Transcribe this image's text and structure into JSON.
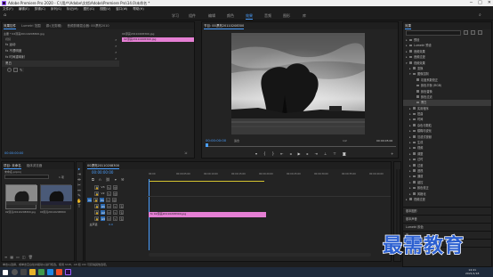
{
  "titlebar": {
    "title": "Adobe Premiere Pro 2020 - C:\\用户\\Adobe\\文档\\Adobe\\Premiere Pro\\14.0\\未命名 *"
  },
  "window_controls": {
    "minimize": "─",
    "maximize": "□",
    "close": "✕"
  },
  "menu": [
    "文件(F)",
    "编辑(E)",
    "剪辑(C)",
    "序列(S)",
    "标记(M)",
    "图形(G)",
    "视图(V)",
    "窗口(W)",
    "帮助(H)"
  ],
  "workspaces": [
    {
      "label": "学习"
    },
    {
      "label": "组件"
    },
    {
      "label": "编辑"
    },
    {
      "label": "颜色"
    },
    {
      "label": "效果",
      "active": true
    },
    {
      "label": "音频"
    },
    {
      "label": "图形"
    },
    {
      "label": "库"
    }
  ],
  "source_panel": {
    "tabs": [
      "效果控件",
      "Lumetri 范围",
      "源:(无剪辑)",
      "音频剪辑混合器: 00漂亮2010"
    ],
    "header": "主要 * 02漂亮20110208300.jpg",
    "seq_header": "00漂亮20110208300.jpg",
    "clip_label": "02漂亮20110208300.jpg",
    "video_label": "视频",
    "rows": [
      "fx  运动",
      "fx  不透明度",
      "fx  时间重映射",
      "  黑白"
    ],
    "timecode": "00:00:00:00"
  },
  "program": {
    "title": "节目: 00漂亮20110208300",
    "timecode_left": "00:00:00:00",
    "fit": "适合",
    "ratio": "1/2",
    "timecode_right": "00:00:05:00"
  },
  "project": {
    "tabs": [
      "项目: 未命名",
      "媒体浏览器"
    ],
    "name": "未命名.prproj",
    "count": "1 项",
    "items": [
      {
        "name": "02漂亮20110208300.jpg",
        "duration": "5:00"
      },
      {
        "name": "00漂亮20110208300",
        "duration": "5:00"
      }
    ]
  },
  "timeline": {
    "title": "00漂亮20110208300",
    "timecode": "00:00:00:00",
    "ruler": [
      "00:00",
      "00:00:05:00",
      "00:00:10:00",
      "00:00:15:00",
      "00:00:20:00",
      "00:00:25:00",
      "00:00:30:00",
      "00:00:35:00",
      "00:00:40:00"
    ],
    "tracks": [
      "V3",
      "V2",
      "V1",
      "A1",
      "A2",
      "A3",
      "主声道"
    ],
    "clip": "fx 02漂亮20110208300.jpg",
    "master_value": "0.0"
  },
  "effects": {
    "title": "效果",
    "items": [
      {
        "label": "预设",
        "indent": 0,
        "tri": "▸"
      },
      {
        "label": "Lumetri 预设",
        "indent": 0,
        "tri": "▸"
      },
      {
        "label": "音频效果",
        "indent": 0,
        "tri": "▸"
      },
      {
        "label": "音频过渡",
        "indent": 0,
        "tri": "▸"
      },
      {
        "label": "视频效果",
        "indent": 0,
        "tri": "▾"
      },
      {
        "label": "变换",
        "indent": 1,
        "tri": "▸"
      },
      {
        "label": "图像控制",
        "indent": 1,
        "tri": "▾"
      },
      {
        "label": "灰度系数校正",
        "indent": 2,
        "tri": ""
      },
      {
        "label": "颜色平衡 (RGB)",
        "indent": 2,
        "tri": ""
      },
      {
        "label": "颜色替换",
        "indent": 2,
        "tri": ""
      },
      {
        "label": "颜色过滤",
        "indent": 2,
        "tri": ""
      },
      {
        "label": "黑白",
        "indent": 2,
        "tri": "",
        "sel": true
      },
      {
        "label": "实用程序",
        "indent": 1,
        "tri": "▸"
      },
      {
        "label": "扭曲",
        "indent": 1,
        "tri": "▸"
      },
      {
        "label": "时间",
        "indent": 1,
        "tri": "▸"
      },
      {
        "label": "杂色与颗粒",
        "indent": 1,
        "tri": "▸"
      },
      {
        "label": "模糊与锐化",
        "indent": 1,
        "tri": "▸"
      },
      {
        "label": "沉浸式视频",
        "indent": 1,
        "tri": "▸"
      },
      {
        "label": "生成",
        "indent": 1,
        "tri": "▸"
      },
      {
        "label": "视频",
        "indent": 1,
        "tri": "▸"
      },
      {
        "label": "调整",
        "indent": 1,
        "tri": "▸"
      },
      {
        "label": "过时",
        "indent": 1,
        "tri": "▸"
      },
      {
        "label": "过渡",
        "indent": 1,
        "tri": "▸"
      },
      {
        "label": "透视",
        "indent": 1,
        "tri": "▸"
      },
      {
        "label": "通道",
        "indent": 1,
        "tri": "▸"
      },
      {
        "label": "键控",
        "indent": 1,
        "tri": "▸"
      },
      {
        "label": "颜色校正",
        "indent": 1,
        "tri": "▸"
      },
      {
        "label": "风格化",
        "indent": 1,
        "tri": "▸"
      },
      {
        "label": "视频过渡",
        "indent": 0,
        "tri": "▸"
      }
    ],
    "sections": [
      "基本图形",
      "基本声音",
      "Lumetri 颜色",
      "库",
      "标记",
      "历史记录"
    ]
  },
  "status": "单击以选择，或单击空白处并拖动以进行框选。使用 Shift、Alt 和 Ctrl 可获得其他选项。",
  "watermark": "最需教育",
  "clock": {
    "time": "14:41",
    "date": "2021/1/18"
  },
  "colors": {
    "accent": "#4a9fff",
    "clip": "#e57fd4"
  }
}
